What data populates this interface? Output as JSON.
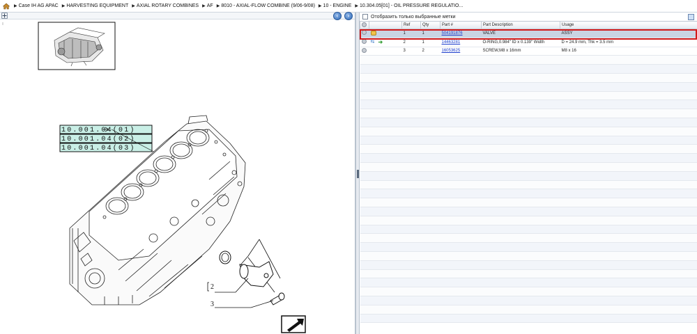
{
  "breadcrumb": {
    "items": [
      "Case IH AG APAC",
      "HARVESTING EQUIPMENT",
      "AXIAL ROTARY COMBINES",
      "AF",
      "8010 - AXIAL-FLOW COMBINE (9/06-9/08)",
      "10 - ENGINE",
      "10.304.05[01] - OIL PRESSURE REGULATIO..."
    ]
  },
  "drawing": {
    "callouts": [
      "10.001.04(01)",
      "10.001.04(02)",
      "10.001.04(03)"
    ],
    "ref_labels": [
      "2",
      "3"
    ]
  },
  "parts_panel": {
    "filter_label": "Отобразить только выбранные метки",
    "columns": [
      "Ref",
      "Qty",
      "Part #",
      "Part Description",
      "Usage"
    ],
    "rows": [
      {
        "ref": "1",
        "qty": "1",
        "part": "504191876",
        "desc": "VALVE",
        "usage": "ASSY",
        "selected": true,
        "icons": [
          "gear-icon",
          "cart-icon"
        ]
      },
      {
        "ref": "2",
        "qty": "1",
        "part": "14463281",
        "desc": "O-RING,0.984\" ID x 0.139\" Width",
        "usage": "D = 24.9 mm, Thk = 3.5 mm",
        "selected": false,
        "icons": [
          "gear-icon",
          "swap-icon",
          "forward-icon"
        ]
      },
      {
        "ref": "3",
        "qty": "2",
        "part": "16053625",
        "desc": "SCREW,M8 x 16mm",
        "usage": "M8 x 16",
        "selected": false,
        "icons": [
          "gear-icon"
        ]
      }
    ]
  },
  "colors": {
    "selection_outline": "#d21a1a",
    "link": "#1a3ccc",
    "callout_fill": "#c9efe6"
  }
}
